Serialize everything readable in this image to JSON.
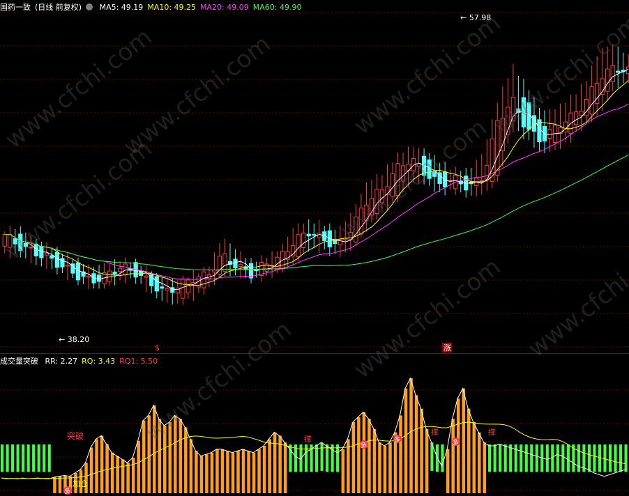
{
  "main_header": {
    "stock": "国药一致",
    "period": "(日线 前复权)",
    "indicators": [
      {
        "label": "MA5: 49.19",
        "color": "#ffffff"
      },
      {
        "label": "MA10: 49.25",
        "color": "#ffff00"
      },
      {
        "label": "MA20: 49.09",
        "color": "#ff3cff"
      },
      {
        "label": "MA60: 49.90",
        "color": "#3cff3c"
      }
    ]
  },
  "sub_header": {
    "name": "成交量突破",
    "indicators": [
      {
        "label": "RR: 2.27",
        "color": "#ffffff"
      },
      {
        "label": "RQ: 3.43",
        "color": "#ffff00"
      },
      {
        "label": "RQ1: 5.50",
        "color": "#ff3c3c"
      }
    ]
  },
  "annotations": {
    "high_label": "57.98",
    "low_label": "38.20",
    "tupo": "突破",
    "jiacang": "加仓",
    "duo": "多",
    "zhang": "涨",
    "cheng": "撑",
    "s_marker": "$"
  },
  "watermark": "www.cfchi.com",
  "colors": {
    "up": "#ff3c3c",
    "down": "#54ffff",
    "orange": "#ff9e18",
    "green": "#40ff40"
  },
  "chart_data": [
    {
      "type": "candlestick",
      "title": "国药一致 (日线 前复权)",
      "ylim": [
        37,
        60
      ],
      "high": 57.98,
      "low": 38.2,
      "candles": [
        [
          44.0,
          44.8,
          45.0,
          43.5
        ],
        [
          44.6,
          44.0,
          45.1,
          43.6
        ],
        [
          44.0,
          43.6,
          44.3,
          43.0
        ],
        [
          43.6,
          43.2,
          43.9,
          42.7
        ],
        [
          43.1,
          42.6,
          43.4,
          42.2
        ],
        [
          42.6,
          42.0,
          42.9,
          41.7
        ],
        [
          42.0,
          41.6,
          42.3,
          41.3
        ],
        [
          41.6,
          42.0,
          42.6,
          41.4
        ],
        [
          42.2,
          42.6,
          42.9,
          41.8
        ],
        [
          42.6,
          42.2,
          42.8,
          41.8
        ],
        [
          42.0,
          41.5,
          42.2,
          41.0
        ],
        [
          41.3,
          40.8,
          41.5,
          40.4
        ],
        [
          40.6,
          41.3,
          41.5,
          40.2
        ],
        [
          41.0,
          41.8,
          42.0,
          40.6
        ],
        [
          41.6,
          42.0,
          42.3,
          41.2
        ],
        [
          42.4,
          43.4,
          44.4,
          42.2
        ],
        [
          43.0,
          42.6,
          43.5,
          42.2
        ],
        [
          42.5,
          42.1,
          42.8,
          41.8
        ],
        [
          42.2,
          42.8,
          43.1,
          42.0
        ],
        [
          42.6,
          43.2,
          43.6,
          42.4
        ],
        [
          43.2,
          44.4,
          45.2,
          43.0
        ],
        [
          44.6,
          45.0,
          45.5,
          44.0
        ],
        [
          45.0,
          44.4,
          45.4,
          43.8
        ],
        [
          44.4,
          44.0,
          44.9,
          43.5
        ],
        [
          44.2,
          45.4,
          46.2,
          44.0
        ],
        [
          45.6,
          47.2,
          48.2,
          45.4
        ],
        [
          47.0,
          47.8,
          48.8,
          46.6
        ],
        [
          47.6,
          49.3,
          50.0,
          47.2
        ],
        [
          49.2,
          50.0,
          50.6,
          48.6
        ],
        [
          50.0,
          49.0,
          50.4,
          48.5
        ],
        [
          49.1,
          48.2,
          49.6,
          47.8
        ],
        [
          48.2,
          48.6,
          49.1,
          47.9
        ],
        [
          48.6,
          48.0,
          49.0,
          47.6
        ],
        [
          48.2,
          48.8,
          50.2,
          47.8
        ],
        [
          49.0,
          52.6,
          53.8,
          48.6
        ],
        [
          52.8,
          54.0,
          56.2,
          52.2
        ],
        [
          54.2,
          52.0,
          54.8,
          51.5
        ],
        [
          52.2,
          51.2,
          53.0,
          50.6
        ],
        [
          51.2,
          52.2,
          53.2,
          50.8
        ],
        [
          52.0,
          52.8,
          54.0,
          51.4
        ],
        [
          52.9,
          53.8,
          55.0,
          52.5
        ],
        [
          53.8,
          55.6,
          57.2,
          53.2
        ],
        [
          55.6,
          56.2,
          57.6,
          55.0
        ],
        [
          56.1,
          56.0,
          56.8,
          55.5
        ]
      ],
      "note": "approximate OHLC sequence across the visible range",
      "ma_lines": [
        {
          "name": "MA5",
          "color": "#ffffff"
        },
        {
          "name": "MA10",
          "color": "#ffff00"
        },
        {
          "name": "MA20",
          "color": "#ff3cff"
        },
        {
          "name": "MA60",
          "color": "#3cff3c"
        }
      ]
    },
    {
      "type": "bar",
      "title": "成交量突破",
      "bars": [
        {
          "v": 0.9,
          "c": "g"
        },
        {
          "v": 0.85,
          "c": "g"
        },
        {
          "v": 0.88,
          "c": "g"
        },
        {
          "v": 0.84,
          "c": "g"
        },
        {
          "v": 0.9,
          "c": "g"
        },
        {
          "v": 0.86,
          "c": "g"
        },
        {
          "v": 0.88,
          "c": "g"
        },
        {
          "v": 0.9,
          "c": "g"
        },
        {
          "v": 0.86,
          "c": "g"
        },
        {
          "v": 0.84,
          "c": "g"
        },
        {
          "v": 0.95,
          "c": "o"
        },
        {
          "v": 1.0,
          "c": "o"
        },
        {
          "v": 1.05,
          "c": "o"
        },
        {
          "v": 1.0,
          "c": "o"
        },
        {
          "v": 1.2,
          "c": "o"
        },
        {
          "v": 1.4,
          "c": "o"
        },
        {
          "v": 1.8,
          "c": "o"
        },
        {
          "v": 2.7,
          "c": "o"
        },
        {
          "v": 3.2,
          "c": "o"
        },
        {
          "v": 3.4,
          "c": "o"
        },
        {
          "v": 2.9,
          "c": "o"
        },
        {
          "v": 2.4,
          "c": "o"
        },
        {
          "v": 2.2,
          "c": "o"
        },
        {
          "v": 2.0,
          "c": "o"
        },
        {
          "v": 1.8,
          "c": "o"
        },
        {
          "v": 2.1,
          "c": "o"
        },
        {
          "v": 3.1,
          "c": "o"
        },
        {
          "v": 4.3,
          "c": "o"
        },
        {
          "v": 4.6,
          "c": "o"
        },
        {
          "v": 5.2,
          "c": "o"
        },
        {
          "v": 4.4,
          "c": "o"
        },
        {
          "v": 4.0,
          "c": "o"
        },
        {
          "v": 4.2,
          "c": "o"
        },
        {
          "v": 4.6,
          "c": "o"
        },
        {
          "v": 4.4,
          "c": "o"
        },
        {
          "v": 3.9,
          "c": "o"
        },
        {
          "v": 3.2,
          "c": "o"
        },
        {
          "v": 2.5,
          "c": "o"
        },
        {
          "v": 2.2,
          "c": "o"
        },
        {
          "v": 2.3,
          "c": "o"
        },
        {
          "v": 2.4,
          "c": "o"
        },
        {
          "v": 2.6,
          "c": "o"
        },
        {
          "v": 2.6,
          "c": "o"
        },
        {
          "v": 2.5,
          "c": "o"
        },
        {
          "v": 2.4,
          "c": "o"
        },
        {
          "v": 2.5,
          "c": "o"
        },
        {
          "v": 2.6,
          "c": "o"
        },
        {
          "v": 2.5,
          "c": "o"
        },
        {
          "v": 2.4,
          "c": "o"
        },
        {
          "v": 2.6,
          "c": "o"
        },
        {
          "v": 2.8,
          "c": "o"
        },
        {
          "v": 3.2,
          "c": "o"
        },
        {
          "v": 3.6,
          "c": "o"
        },
        {
          "v": 3.4,
          "c": "o"
        },
        {
          "v": 3.0,
          "c": "o"
        },
        {
          "v": 2.6,
          "c": "g"
        },
        {
          "v": 2.2,
          "c": "g"
        },
        {
          "v": 2.0,
          "c": "g"
        },
        {
          "v": 2.4,
          "c": "g"
        },
        {
          "v": 2.6,
          "c": "g"
        },
        {
          "v": 2.8,
          "c": "g"
        },
        {
          "v": 3.0,
          "c": "g"
        },
        {
          "v": 2.8,
          "c": "g"
        },
        {
          "v": 2.6,
          "c": "g"
        },
        {
          "v": 2.4,
          "c": "g"
        },
        {
          "v": 2.6,
          "c": "o"
        },
        {
          "v": 3.2,
          "c": "o"
        },
        {
          "v": 4.2,
          "c": "o"
        },
        {
          "v": 4.5,
          "c": "o"
        },
        {
          "v": 4.8,
          "c": "o"
        },
        {
          "v": 4.4,
          "c": "o"
        },
        {
          "v": 3.8,
          "c": "o"
        },
        {
          "v": 3.0,
          "c": "o"
        },
        {
          "v": 2.8,
          "c": "o"
        },
        {
          "v": 3.0,
          "c": "o"
        },
        {
          "v": 3.6,
          "c": "o"
        },
        {
          "v": 4.6,
          "c": "o"
        },
        {
          "v": 6.2,
          "c": "o"
        },
        {
          "v": 6.8,
          "c": "o"
        },
        {
          "v": 5.8,
          "c": "o"
        },
        {
          "v": 5.0,
          "c": "o"
        },
        {
          "v": 3.8,
          "c": "o"
        },
        {
          "v": 3.0,
          "c": "g"
        },
        {
          "v": 2.2,
          "c": "g"
        },
        {
          "v": 1.6,
          "c": "g"
        },
        {
          "v": 2.6,
          "c": "o"
        },
        {
          "v": 4.4,
          "c": "o"
        },
        {
          "v": 5.6,
          "c": "o"
        },
        {
          "v": 6.2,
          "c": "o"
        },
        {
          "v": 5.0,
          "c": "o"
        },
        {
          "v": 4.2,
          "c": "o"
        },
        {
          "v": 3.6,
          "c": "o"
        },
        {
          "v": 3.0,
          "c": "o"
        },
        {
          "v": 2.8,
          "c": "g"
        },
        {
          "v": 2.8,
          "c": "g"
        },
        {
          "v": 2.9,
          "c": "g"
        },
        {
          "v": 2.8,
          "c": "g"
        },
        {
          "v": 2.7,
          "c": "g"
        },
        {
          "v": 2.6,
          "c": "g"
        },
        {
          "v": 2.5,
          "c": "g"
        },
        {
          "v": 2.4,
          "c": "g"
        },
        {
          "v": 2.3,
          "c": "g"
        },
        {
          "v": 2.2,
          "c": "g"
        },
        {
          "v": 2.1,
          "c": "g"
        },
        {
          "v": 2.0,
          "c": "g"
        },
        {
          "v": 2.1,
          "c": "g"
        },
        {
          "v": 2.3,
          "c": "g"
        },
        {
          "v": 2.2,
          "c": "g"
        },
        {
          "v": 2.0,
          "c": "g"
        },
        {
          "v": 1.8,
          "c": "g"
        },
        {
          "v": 1.6,
          "c": "g"
        },
        {
          "v": 1.5,
          "c": "g"
        },
        {
          "v": 1.4,
          "c": "g"
        },
        {
          "v": 1.2,
          "c": "g"
        },
        {
          "v": 1.1,
          "c": "g"
        },
        {
          "v": 1.0,
          "c": "g"
        },
        {
          "v": 1.1,
          "c": "g"
        },
        {
          "v": 1.2,
          "c": "g"
        },
        {
          "v": 1.3,
          "c": "g"
        },
        {
          "v": 1.4,
          "c": "g"
        }
      ],
      "ylim": [
        0,
        7.5
      ]
    }
  ]
}
